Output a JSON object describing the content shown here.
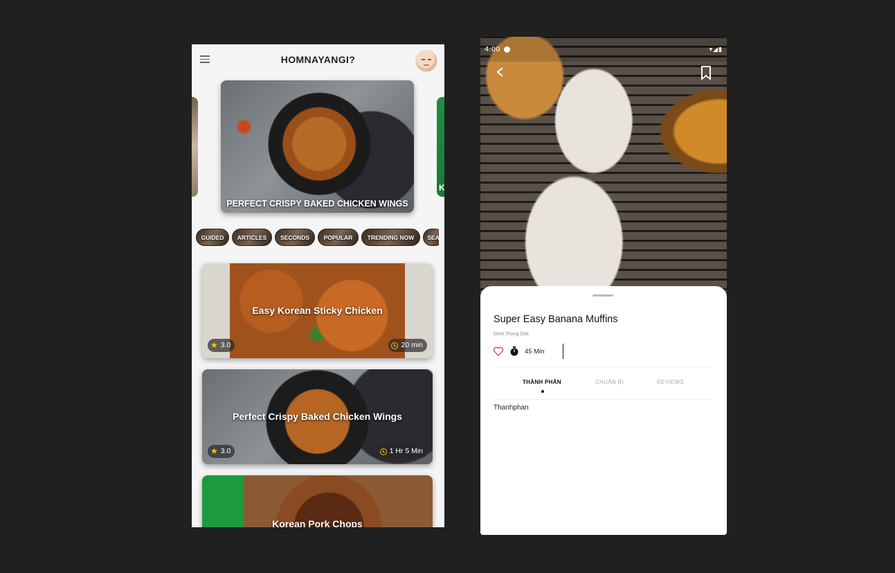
{
  "left_app": {
    "title": "HOMNAYANGI?",
    "hero": {
      "title": "PERFECT CRISPY BAKED CHICKEN WINGS",
      "next_peek": "K"
    },
    "chips": [
      "GUIDED",
      "ARTICLES",
      "SECONDS",
      "POPULAR",
      "TRENDING NOW",
      "SEA"
    ],
    "cards": [
      {
        "title": "Easy Korean Sticky Chicken",
        "rating": "3.0",
        "time": "20 min"
      },
      {
        "title": "Perfect Crispy Baked Chicken Wings",
        "rating": "3.0",
        "time": "1 Hr 5 Min"
      },
      {
        "title": "Korean Pork Chops"
      }
    ]
  },
  "right_app": {
    "status_bar": {
      "time": "4:00"
    },
    "recipe": {
      "title": "Super Easy Banana Muffins",
      "author": "Dinh Trong Dat",
      "duration": "45 Min"
    },
    "tabs": [
      {
        "label": "THÀNH PHẦN",
        "active": true
      },
      {
        "label": "CHUẨN BỊ",
        "active": false
      },
      {
        "label": "REVIEWS",
        "active": false
      }
    ],
    "tab_content": "Thanhphan"
  },
  "colors": {
    "accent_star": "#f5c518",
    "heart": "#d9534f",
    "background": "#202020"
  }
}
